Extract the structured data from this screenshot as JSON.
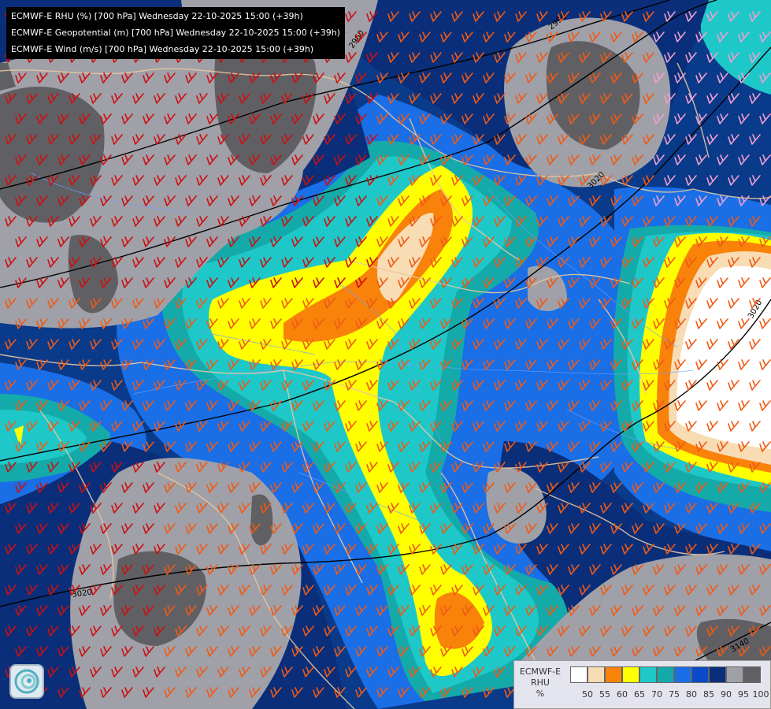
{
  "titles": [
    "ECMWF-E RHU (%) [700 hPa] Wednesday 22-10-2025 15:00 (+39h)",
    "ECMWF-E Geopotential (m) [700 hPa] Wednesday 22-10-2025 15:00 (+39h)",
    "ECMWF-E Wind (m/s) [700 hPa] Wednesday 22-10-2025 15:00 (+39h)"
  ],
  "contour_labels": [
    "2960",
    "2990",
    "3020",
    "3020",
    "3020",
    "3140"
  ],
  "legend": {
    "title_lines": [
      "ECMWF-E",
      "RHU",
      "%"
    ],
    "ticks": [
      "50",
      "55",
      "60",
      "65",
      "70",
      "75",
      "80",
      "85",
      "90",
      "95",
      "100"
    ],
    "colors": [
      "#ffffff",
      "#f8dcb4",
      "#f8820a",
      "#ffff00",
      "#1ec8c8",
      "#14aaaa",
      "#1a6ee6",
      "#0a4ac8",
      "#0a2e7a",
      "#a0a0a8",
      "#606064"
    ]
  },
  "logo_icon": "ecmwf-spiral-logo-icon"
}
